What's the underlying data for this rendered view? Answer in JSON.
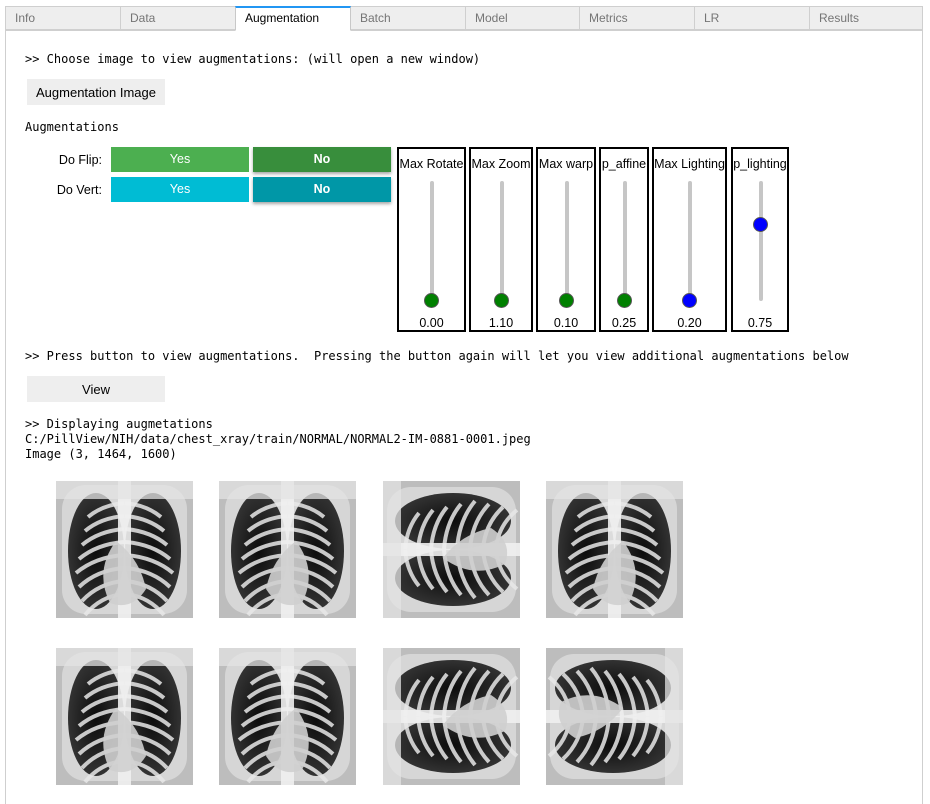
{
  "tabs": [
    "Info",
    "Data",
    "Augmentation",
    "Batch",
    "Model",
    "Metrics",
    "LR",
    "Results"
  ],
  "active_tab": "Augmentation",
  "choose_text": ">> Choose image to view augmentations: (will open a new window)",
  "aug_image_button": "Augmentation Image",
  "augmentations_label": "Augmentations",
  "toggles": [
    {
      "label": "Do Flip:",
      "yes": "Yes",
      "no": "No",
      "selected": "No",
      "yes_color": "#4caf50",
      "no_color": "#388e3c"
    },
    {
      "label": "Do Vert:",
      "yes": "Yes",
      "no": "No",
      "selected": "No",
      "yes_color": "#00bcd4",
      "no_color": "#0097a7"
    }
  ],
  "sliders": [
    {
      "name": "Max Rotate",
      "value": "0.00",
      "level": 0.0,
      "handle_color": "#008000"
    },
    {
      "name": "Max Zoom",
      "value": "1.10",
      "level": 0.0,
      "handle_color": "#008000"
    },
    {
      "name": "Max warp",
      "value": "0.10",
      "level": 0.0,
      "handle_color": "#008000"
    },
    {
      "name": "p_affine",
      "value": "0.25",
      "level": 0.0,
      "handle_color": "#008000"
    },
    {
      "name": "Max Lighting",
      "value": "0.20",
      "level": 0.0,
      "handle_color": "#0000ff"
    },
    {
      "name": "p_lighting",
      "value": "0.75",
      "level": 0.63,
      "handle_color": "#0000ff"
    }
  ],
  "press_text": ">> Press button to view augmentations.  Pressing the button again will let you view additional augmentations below",
  "view_button": "View",
  "displaying_text": ">> Displaying augmetations",
  "path_text": "C:/PillView/NIH/data/chest_xray/train/NORMAL/NORMAL2-IM-0881-0001.jpeg",
  "image_shape_text": "Image (3, 1464, 1600)",
  "augmented_images": [
    "xray-augmentation-1",
    "xray-augmentation-2",
    "xray-augmentation-3",
    "xray-augmentation-4",
    "xray-augmentation-5",
    "xray-augmentation-6",
    "xray-augmentation-7",
    "xray-augmentation-8"
  ]
}
